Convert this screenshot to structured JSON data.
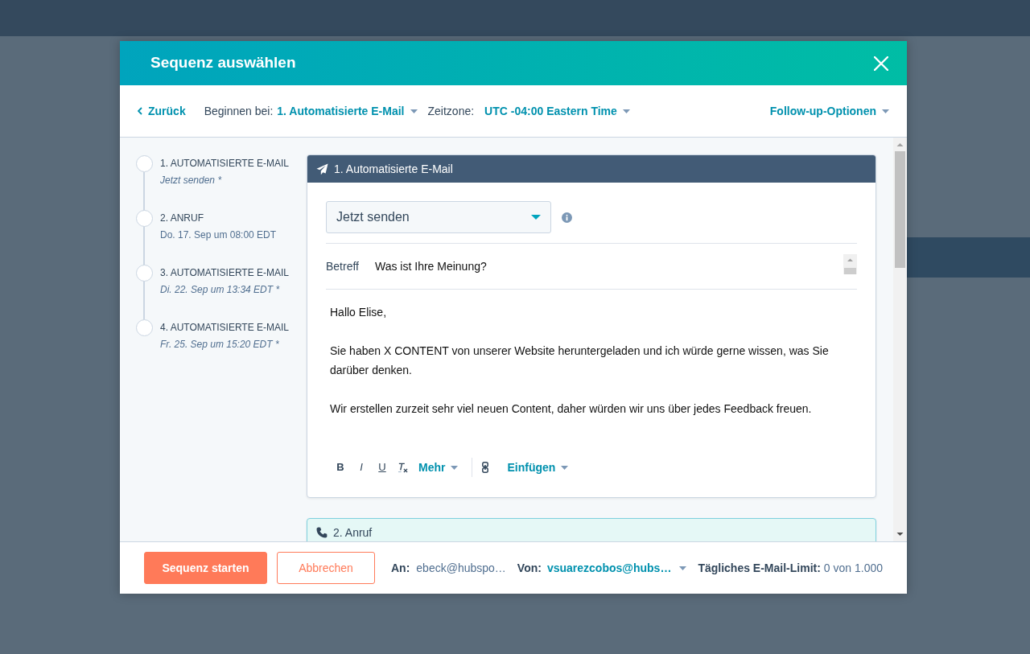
{
  "dialog": {
    "title": "Sequenz auswählen"
  },
  "toolbar": {
    "back": "Zurück",
    "start_at": {
      "label": "Beginnen bei:",
      "value": "1. Automatisierte E-Mail"
    },
    "timezone": {
      "label": "Zeitzone:",
      "value": "UTC -04:00 Eastern Time"
    },
    "follow_up": "Follow-up-Optionen"
  },
  "steps": [
    {
      "title": "1. AUTOMATISIERTE E-MAIL",
      "detail": "Jetzt senden *",
      "italic": true
    },
    {
      "title": "2. ANRUF",
      "detail": "Do. 17. Sep um 08:00 EDT",
      "italic": false
    },
    {
      "title": "3. AUTOMATISIERTE E-MAIL",
      "detail": "Di. 22. Sep um 13:34 EDT *",
      "italic": true
    },
    {
      "title": "4. AUTOMATISIERTE E-MAIL",
      "detail": "Fr. 25. Sep um 15:20 EDT *",
      "italic": true
    }
  ],
  "cards": [
    {
      "kind": "email",
      "title": "1. Automatisierte E-Mail",
      "send_time": "Jetzt senden",
      "subject_label": "Betreff",
      "subject": "Was ist Ihre Meinung?",
      "body": [
        "Hallo Elise,",
        "Sie haben X CONTENT von unserer Website heruntergeladen und ich würde gerne wissen, was Sie darüber denken.",
        "Wir erstellen zurzeit sehr viel neuen Content, daher würden wir uns über jedes Feedback freuen."
      ],
      "editor_toolbar": [
        {
          "kind": "bold",
          "label": "B"
        },
        {
          "kind": "italic",
          "label": "I"
        },
        {
          "kind": "underline",
          "label": "U"
        },
        {
          "kind": "clear_format"
        },
        {
          "kind": "menu",
          "label": "Mehr"
        },
        {
          "kind": "separator"
        },
        {
          "kind": "link"
        },
        {
          "kind": "menu",
          "label": "Einfügen"
        }
      ]
    },
    {
      "kind": "call",
      "title": "2. Anruf"
    }
  ],
  "footer": {
    "start_button": "Sequenz starten",
    "cancel_button": "Abbrechen",
    "to_label": "An:",
    "to": "ebeck@hubspo…",
    "from_label": "Von:",
    "from": "vsuarezcobos@hubs…",
    "limit_label": "Tägliches E-Mail-Limit:",
    "limit": "0 von 1.000"
  }
}
